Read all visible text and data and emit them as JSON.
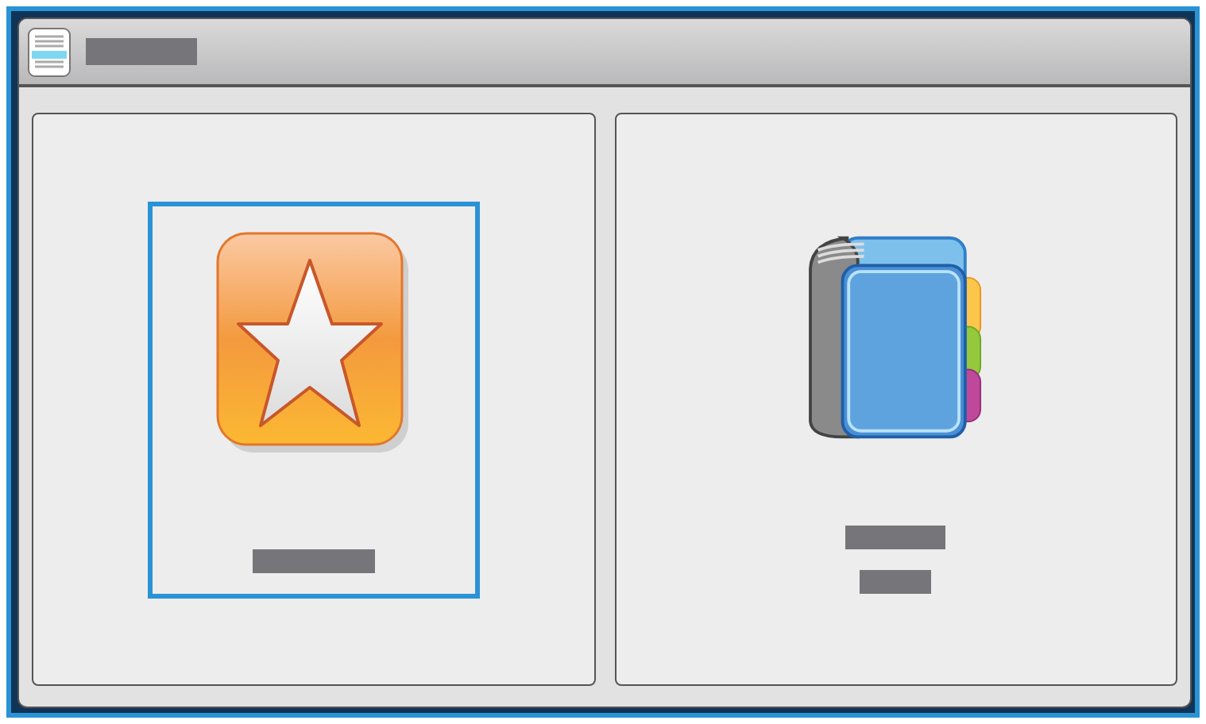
{
  "tiles": [
    {
      "kind": "favorites",
      "selected": true
    },
    {
      "kind": "address_book",
      "selected": false
    }
  ]
}
